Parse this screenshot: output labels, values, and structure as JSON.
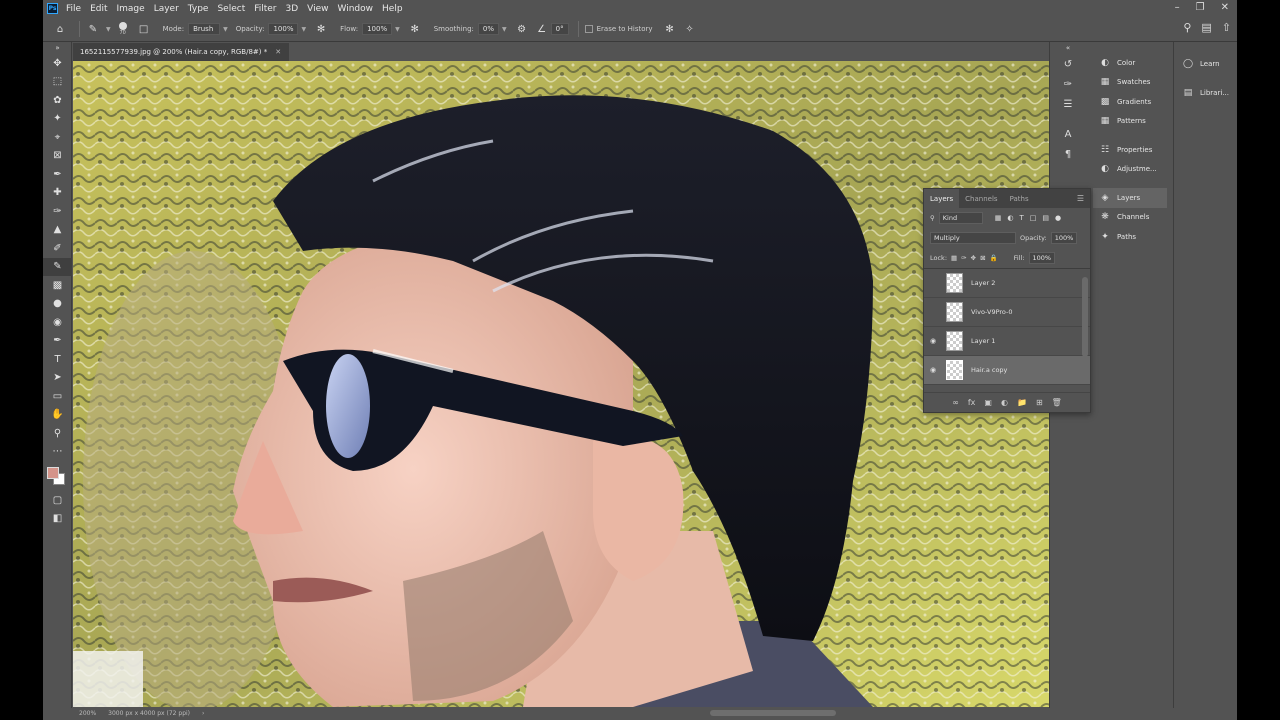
{
  "app": {
    "logo_text": "Ps"
  },
  "menu": [
    "File",
    "Edit",
    "Image",
    "Layer",
    "Type",
    "Select",
    "Filter",
    "3D",
    "View",
    "Window",
    "Help"
  ],
  "options_bar": {
    "brush_size": "70",
    "mode_label": "Mode:",
    "mode_value": "Brush",
    "opacity_label": "Opacity:",
    "opacity_value": "100%",
    "flow_label": "Flow:",
    "flow_value": "100%",
    "smoothing_label": "Smoothing:",
    "smoothing_value": "0%",
    "angle_value": "0°",
    "erase_history_label": "Erase to History"
  },
  "document": {
    "tab_title": "1652115577939.jpg @ 200% (Hair.a copy, RGB/8#) *",
    "zoom": "200%",
    "dimensions": "3000 px x 4000 px (72 ppi)"
  },
  "colors": {
    "foreground": "#d4948a",
    "background": "#ffffff",
    "accent": "#31a8ff"
  },
  "panels": {
    "group1": [
      "Color",
      "Swatches",
      "Gradients",
      "Patterns"
    ],
    "group2": [
      "Properties",
      "Adjustme..."
    ],
    "group3": [
      "Layers",
      "Channels",
      "Paths"
    ],
    "learn": [
      "Learn",
      "Librari..."
    ]
  },
  "layers_panel": {
    "tabs": [
      "Layers",
      "Channels",
      "Paths"
    ],
    "filter_label": "Kind",
    "blend_mode": "Multiply",
    "opacity_label": "Opacity:",
    "opacity_value": "100%",
    "lock_label": "Lock:",
    "fill_label": "Fill:",
    "fill_value": "100%",
    "layers": [
      {
        "name": "Layer 2",
        "visible": false,
        "selected": false
      },
      {
        "name": "Vivo-V9Pro-0",
        "visible": false,
        "selected": false
      },
      {
        "name": "Layer 1",
        "visible": true,
        "selected": false
      },
      {
        "name": "Hair.a copy",
        "visible": true,
        "selected": true
      }
    ]
  }
}
